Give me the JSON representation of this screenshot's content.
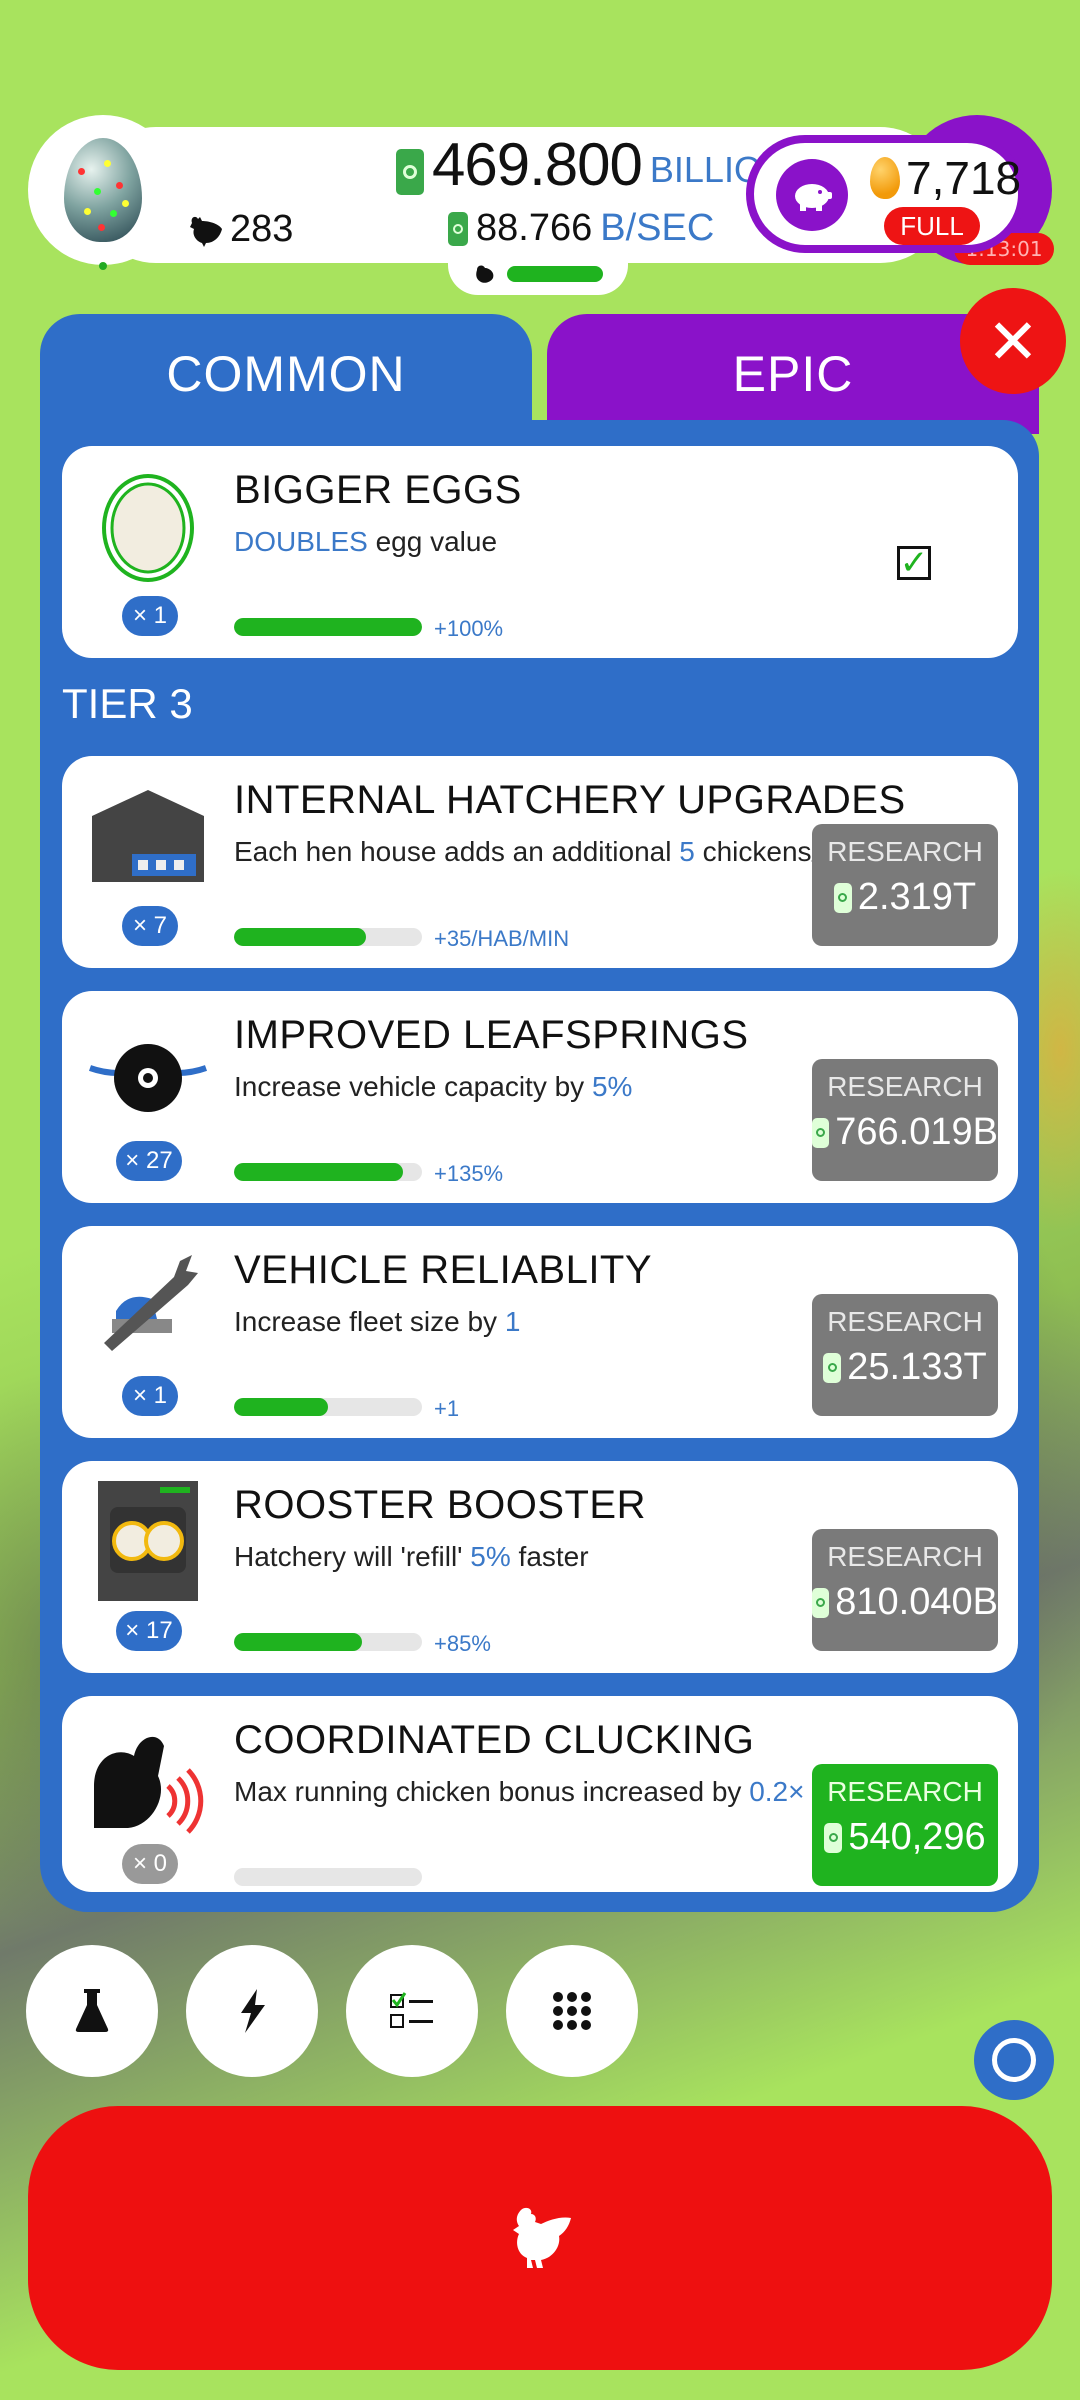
{
  "header": {
    "chicken_count": "283",
    "money_value": "469.800",
    "money_unit": "BILLION",
    "rate_value": "88.766",
    "rate_unit": "B/SEC",
    "golden_eggs": "7,718",
    "piggy_status": "FULL",
    "timer": "1:13:01"
  },
  "tabs": [
    {
      "label": "COMMON"
    },
    {
      "label": "EPIC"
    }
  ],
  "top_card": {
    "title": "BIGGER EGGS",
    "desc_highlight": "DOUBLES",
    "desc_rest": " egg value",
    "bonus": "+100%",
    "level": "× 1",
    "progress": 1.0,
    "completed": true
  },
  "tier_label": "TIER 3",
  "research_items": [
    {
      "title": "INTERNAL HATCHERY UPGRADES",
      "desc_pre": "Each hen house adds an additional ",
      "desc_hl": "5",
      "desc_post": " chickens/min",
      "bonus": "+35/HAB/MIN",
      "level": "× 7",
      "progress": 0.7,
      "button_label": "RESEARCH",
      "cost": "2.319T"
    },
    {
      "title": "IMPROVED LEAFSPRINGS",
      "desc_pre": "Increase vehicle capacity by ",
      "desc_hl": "5%",
      "desc_post": "",
      "bonus": "+135%",
      "level": "× 27",
      "progress": 0.9,
      "button_label": "RESEARCH",
      "cost": "766.019B"
    },
    {
      "title": "VEHICLE RELIABLITY",
      "desc_pre": "Increase fleet size by ",
      "desc_hl": "1",
      "desc_post": "",
      "bonus": "+1",
      "level": "× 1",
      "progress": 0.5,
      "button_label": "RESEARCH",
      "cost": "25.133T"
    },
    {
      "title": "ROOSTER BOOSTER",
      "desc_pre": "Hatchery will 'refill' ",
      "desc_hl": "5%",
      "desc_post": " faster",
      "bonus": "+85%",
      "level": "× 17",
      "progress": 0.68,
      "button_label": "RESEARCH",
      "cost": "810.040B"
    },
    {
      "title": "COORDINATED CLUCKING",
      "desc_pre": "Max running chicken bonus increased by ",
      "desc_hl": "0.2×",
      "desc_post": "",
      "bonus": "",
      "level": "× 0",
      "progress": 0,
      "button_label": "RESEARCH",
      "cost": "540,296"
    }
  ],
  "bottom_buttons": [
    "flask-icon",
    "lightning-icon",
    "checklist-icon",
    "grid-icon"
  ],
  "colors": {
    "primary_blue": "#2f6ec8",
    "epic_purple": "#8a12c9",
    "alert_red": "#ee1414",
    "progress_green": "#1fb31f",
    "background_green": "#a8e35e"
  }
}
